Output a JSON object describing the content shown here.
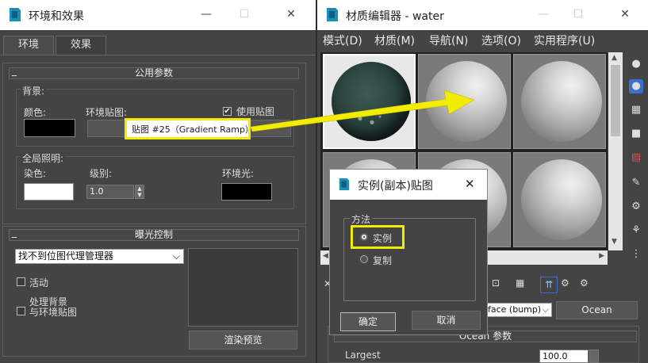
{
  "env_window": {
    "title": "环境和效果",
    "tabs": [
      "环境",
      "效果"
    ],
    "common_params": {
      "header": "公用参数",
      "background_group": "背景:",
      "color_label": "颜色:",
      "env_map_label": "环境贴图:",
      "use_map_label": "使用贴图",
      "use_map_checked": true,
      "map_button": "贴图 #25（Gradient Ramp）",
      "global_lighting_group": "全局照明:",
      "tint_label": "染色:",
      "level_label": "级别:",
      "level_value": "1.0",
      "ambient_label": "环境光:"
    },
    "exposure": {
      "header": "曝光控制",
      "dropdown_value": "找不到位图代理管理器",
      "active_label": "活动",
      "process_bg_label_1": "处理背景",
      "process_bg_label_2": "与环境贴图",
      "render_preview_button": "渲染预览"
    },
    "colors": {
      "background": "#000000",
      "tint": "#ffffff",
      "ambient": "#000000"
    }
  },
  "mat_editor": {
    "title": "材质编辑器 - water",
    "menu": [
      "模式(D)",
      "材质(M)",
      "导航(N)",
      "选项(O)",
      "实用程序(U)"
    ],
    "map_type_fragment": "face (bump)",
    "map_name_button": "Ocean",
    "ocean_header": "Ocean 参数",
    "largest_label": "Largest",
    "largest_value": "100.0"
  },
  "dialog": {
    "title": "实例(副本)贴图",
    "group_label": "方法",
    "options": [
      "实例",
      "复制"
    ],
    "selected": "实例",
    "ok_button": "确定",
    "cancel_button": "取消"
  },
  "accent": {
    "highlight": "#f2ec00",
    "dialog_icon": "#1a8fb5"
  }
}
